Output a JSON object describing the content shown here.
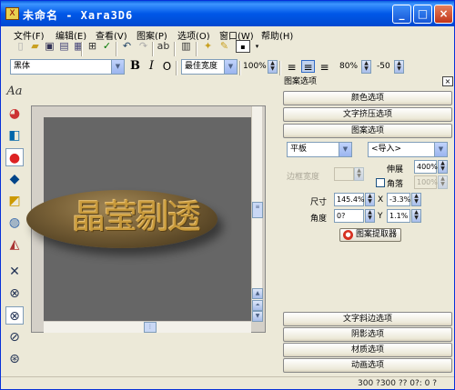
{
  "window": {
    "title": "未命名 - Xara3D6",
    "app_icon": "xara3d-icon"
  },
  "titlebar_buttons": {
    "minimize": "_",
    "maximize": "□",
    "close": "×"
  },
  "menu": [
    "文件(F)",
    "编辑(E)",
    "查看(V)",
    "图案(P)",
    "选项(O)",
    "窗口(W)",
    "帮助(H)"
  ],
  "font_toolbar": {
    "font": "黑体",
    "bold": "B",
    "italic": "I",
    "outline": "O",
    "width_mode": "最佳宽度",
    "width_percent": "100%",
    "align_left": "≡",
    "align_center": "≡",
    "align_right": "≡",
    "line_spacing": "80%",
    "char_spacing": "-50"
  },
  "canvas": {
    "text": "晶莹剔透",
    "background": "#666666",
    "text_color": "#c89a3c"
  },
  "panel": {
    "title": "图案选项",
    "close": "×",
    "sections_top": [
      "颜色选项",
      "文字挤压选项",
      "图案选项"
    ],
    "shape_select": "平板",
    "import_select": "<导入>",
    "border_width_label": "边框宽度",
    "extend_label": "伸展",
    "extend_value": "400%",
    "corner_label": "角落",
    "corner_value": "100%",
    "size_label": "尺寸",
    "size_value": "145.4%",
    "x_label": "X",
    "x_value": "-3.3%",
    "angle_label": "角度",
    "angle_value": "0?",
    "y_label": "Y",
    "y_value": "1.1%",
    "extract_button": "图案提取器",
    "sections_bottom": [
      "文字斜边选项",
      "阴影选项",
      "材质选项",
      "动画选项"
    ]
  },
  "status": {
    "text": "300 ?300 ?? 0?: 0 ?"
  }
}
